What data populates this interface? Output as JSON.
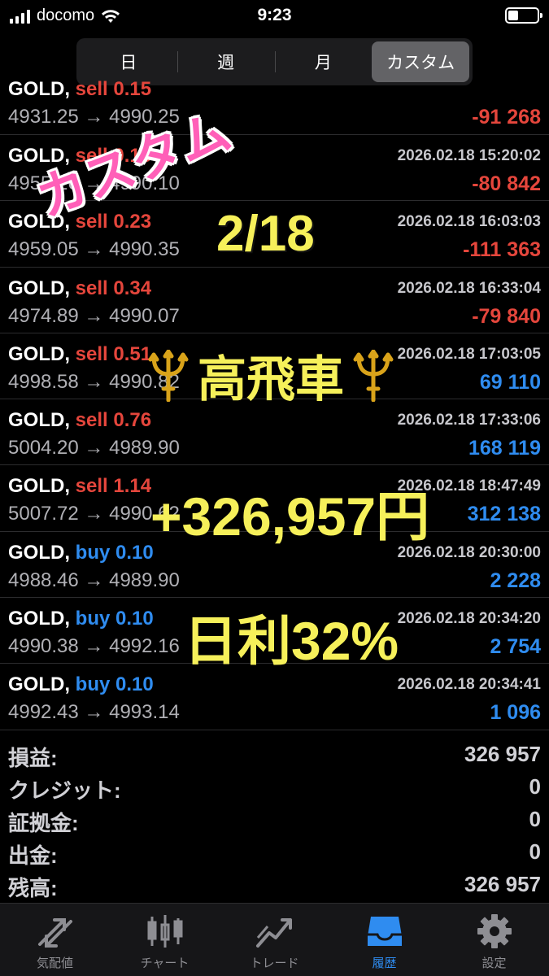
{
  "status_bar": {
    "carrier": "docomo",
    "time": "9:23"
  },
  "segments": [
    "日",
    "週",
    "月",
    "カスタム"
  ],
  "active_segment": 3,
  "trades": [
    {
      "symbol": "GOLD,",
      "type": "sell",
      "volume": "0.15",
      "type_class": "sell",
      "time": "",
      "prices": "4931.25 → 4990.25",
      "profit": "-91 268",
      "profit_class": "neg"
    },
    {
      "symbol": "GOLD,",
      "type": "sell",
      "volume": "0.15",
      "type_class": "sell",
      "time": "2026.02.18 15:20:02",
      "prices": "4955.26 → 4990.10",
      "profit": "-80 842",
      "profit_class": "neg"
    },
    {
      "symbol": "GOLD,",
      "type": "sell",
      "volume": "0.23",
      "type_class": "sell",
      "time": "2026.02.18 16:03:03",
      "prices": "4959.05 → 4990.35",
      "profit": "-111 363",
      "profit_class": "neg"
    },
    {
      "symbol": "GOLD,",
      "type": "sell",
      "volume": "0.34",
      "type_class": "sell",
      "time": "2026.02.18 16:33:04",
      "prices": "4974.89 → 4990.07",
      "profit": "-79 840",
      "profit_class": "neg"
    },
    {
      "symbol": "GOLD,",
      "type": "sell",
      "volume": "0.51",
      "type_class": "sell",
      "time": "2026.02.18 17:03:05",
      "prices": "4998.58 → 4990.82",
      "profit": "69 110",
      "profit_class": "pos"
    },
    {
      "symbol": "GOLD,",
      "type": "sell",
      "volume": "0.76",
      "type_class": "sell",
      "time": "2026.02.18 17:33:06",
      "prices": "5004.20 → 4989.90",
      "profit": "168 119",
      "profit_class": "pos"
    },
    {
      "symbol": "GOLD,",
      "type": "sell",
      "volume": "1.14",
      "type_class": "sell",
      "time": "2026.02.18 18:47:49",
      "prices": "5007.72 → 4990.62",
      "profit": "312 138",
      "profit_class": "pos"
    },
    {
      "symbol": "GOLD,",
      "type": "buy",
      "volume": "0.10",
      "type_class": "buy",
      "time": "2026.02.18 20:30:00",
      "prices": "4988.46 → 4989.90",
      "profit": "2 228",
      "profit_class": "pos"
    },
    {
      "symbol": "GOLD,",
      "type": "buy",
      "volume": "0.10",
      "type_class": "buy",
      "time": "2026.02.18 20:34:20",
      "prices": "4990.38 → 4992.16",
      "profit": "2 754",
      "profit_class": "pos"
    },
    {
      "symbol": "GOLD,",
      "type": "buy",
      "volume": "0.10",
      "type_class": "buy",
      "time": "2026.02.18 20:34:41",
      "prices": "4992.43 → 4993.14",
      "profit": "1 096",
      "profit_class": "pos"
    }
  ],
  "summary": [
    {
      "label": "損益:",
      "value": "326 957"
    },
    {
      "label": "クレジット:",
      "value": "0"
    },
    {
      "label": "証拠金:",
      "value": "0"
    },
    {
      "label": "出金:",
      "value": "0"
    },
    {
      "label": "残高:",
      "value": "326 957"
    }
  ],
  "tabs": [
    {
      "label": "気配値",
      "icon": "quotes-arrows-icon"
    },
    {
      "label": "チャート",
      "icon": "candlestick-chart-icon"
    },
    {
      "label": "トレード",
      "icon": "trade-line-icon"
    },
    {
      "label": "履歴",
      "icon": "history-tray-icon"
    },
    {
      "label": "設定",
      "icon": "settings-gear-icon"
    }
  ],
  "active_tab": 3,
  "overlays": {
    "custom": "カスタム",
    "date": "2/18",
    "car": "高飛車",
    "profit": "+326,957円",
    "rate": "日利32%"
  },
  "colors": {
    "sell": "#e5463c",
    "buy": "#2f8cf0",
    "overlay_yellow": "#f6f05a",
    "overlay_pink": "#ff5fb8"
  }
}
